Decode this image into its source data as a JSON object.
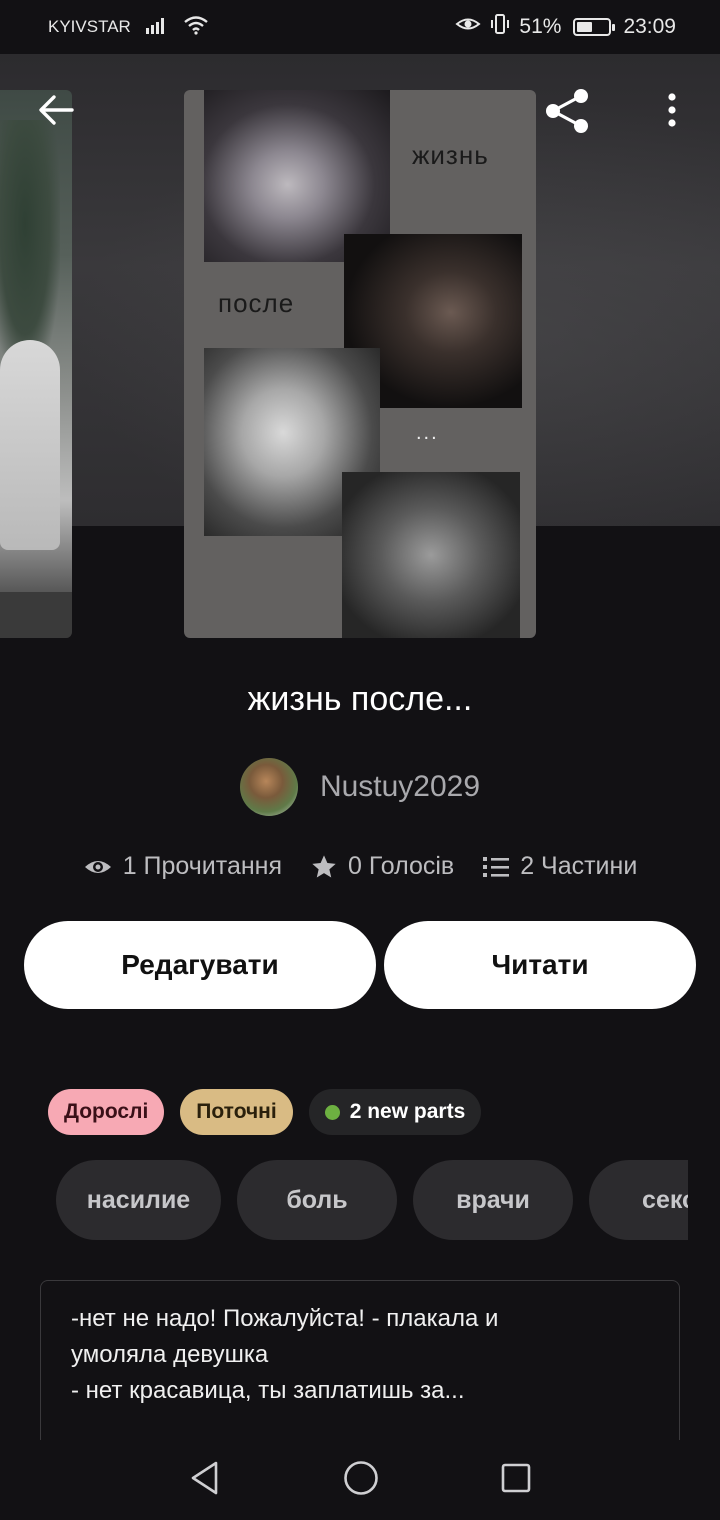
{
  "status_bar": {
    "carrier": "KYIVSTAR",
    "battery_percent": "51%",
    "battery_level": 0.51,
    "time": "23:09"
  },
  "cover": {
    "word_1": "жизнь",
    "word_2": "после",
    "word_3": "..."
  },
  "story": {
    "title": "жизнь после...",
    "author": "Nustuy2029"
  },
  "stats": {
    "reads": "1 Прочитання",
    "votes": "0 Голосів",
    "parts": "2 Частини"
  },
  "actions": {
    "edit_label": "Редагувати",
    "read_label": "Читати"
  },
  "badges": {
    "mature": "Дорослі",
    "ongoing": "Поточні",
    "new_parts": "2 new parts"
  },
  "tags": [
    "насилие",
    "боль",
    "врачи",
    "секс"
  ],
  "description": {
    "line_1": "-нет не надо! Пожалуйста! - плакала и",
    "line_2": "умоляла девушка",
    "line_3": "- нет красавица, ты заплатишь за..."
  },
  "colors": {
    "background": "#121114",
    "mature_badge": "#f7a9b4",
    "ongoing_badge": "#d9bb84",
    "new_parts_dot": "#6db041"
  }
}
